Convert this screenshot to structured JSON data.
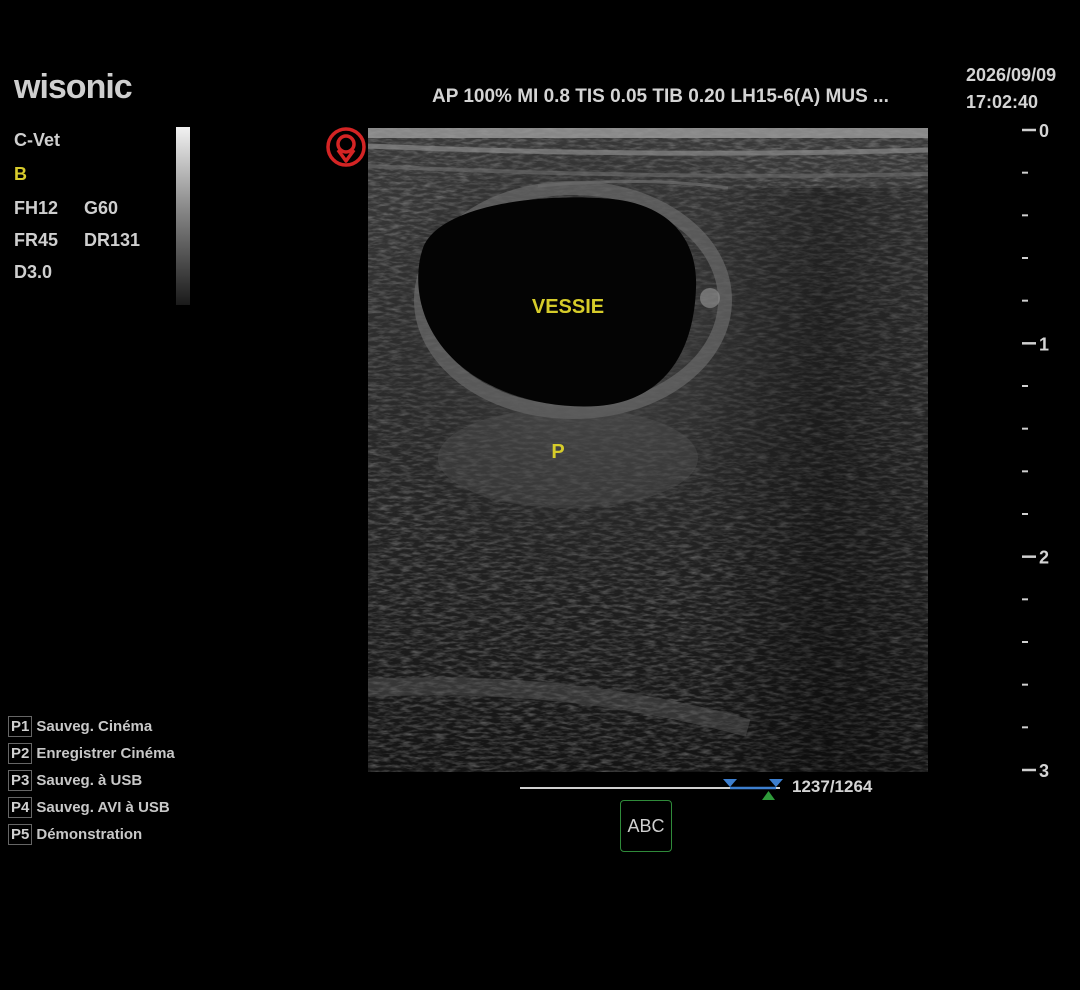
{
  "brand": {
    "logo": "wisonic"
  },
  "mode_panel": {
    "app": "C-Vet",
    "mode": "B",
    "fh": "FH12",
    "gain": "G60",
    "fr": "FR45",
    "dr": "DR131",
    "depth": "D3.0",
    "mode_color": "#d8cc2c"
  },
  "header": {
    "info": "AP 100% MI 0.8 TIS 0.05 TIB 0.20 LH15-6(A)  MUS ...",
    "date": "2026/09/09",
    "time": "17:02:40"
  },
  "image": {
    "annotations": [
      {
        "text": "VESSIE"
      },
      {
        "text": "P"
      }
    ],
    "annotation_color": "#d6cc2a"
  },
  "depth_scale": {
    "labels": [
      "0",
      "1",
      "2",
      "3"
    ],
    "max_cm": 3
  },
  "cine": {
    "counter": "1237/1264",
    "current_frame": 1237,
    "total_frames": 1264
  },
  "abc_button": {
    "label": "ABC",
    "icon": "text-annotation-icon"
  },
  "preset_keys": [
    {
      "key": "P1",
      "label": "Sauveg. Cinéma"
    },
    {
      "key": "P2",
      "label": "Enregistrer Cinéma"
    },
    {
      "key": "P3",
      "label": "Sauveg. à USB"
    },
    {
      "key": "P4",
      "label": "Sauveg. AVI à USB"
    },
    {
      "key": "P5",
      "label": "Démonstration"
    }
  ]
}
